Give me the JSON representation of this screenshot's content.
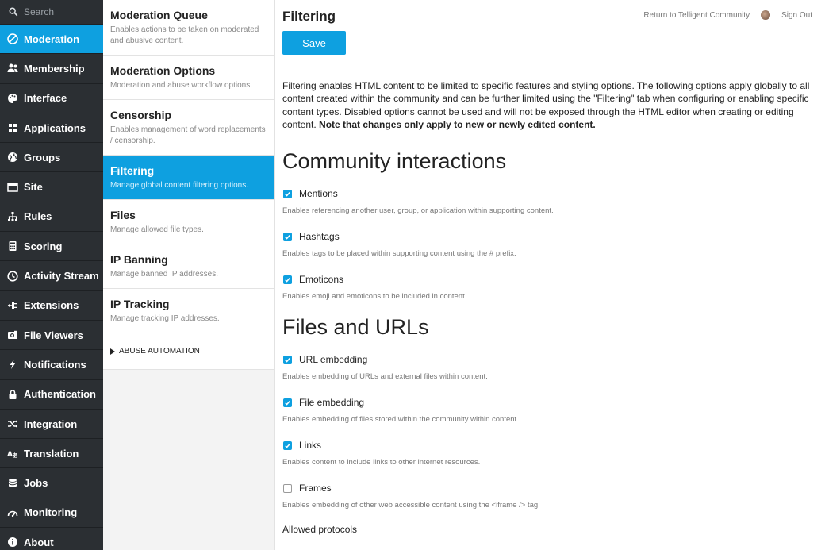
{
  "search": {
    "placeholder": "Search"
  },
  "nav": [
    {
      "label": "Moderation",
      "icon": "moderation-icon",
      "active": true
    },
    {
      "label": "Membership",
      "icon": "membership-icon"
    },
    {
      "label": "Interface",
      "icon": "palette-icon"
    },
    {
      "label": "Applications",
      "icon": "grid-icon"
    },
    {
      "label": "Groups",
      "icon": "globe-icon"
    },
    {
      "label": "Site",
      "icon": "window-icon"
    },
    {
      "label": "Rules",
      "icon": "hierarchy-icon"
    },
    {
      "label": "Scoring",
      "icon": "calculator-icon"
    },
    {
      "label": "Activity Stream",
      "icon": "clock-icon"
    },
    {
      "label": "Extensions",
      "icon": "plug-icon"
    },
    {
      "label": "File Viewers",
      "icon": "camera-icon"
    },
    {
      "label": "Notifications",
      "icon": "bolt-icon"
    },
    {
      "label": "Authentication",
      "icon": "lock-icon"
    },
    {
      "label": "Integration",
      "icon": "shuffle-icon"
    },
    {
      "label": "Translation",
      "icon": "translate-icon"
    },
    {
      "label": "Jobs",
      "icon": "database-icon"
    },
    {
      "label": "Monitoring",
      "icon": "gauge-icon"
    },
    {
      "label": "About",
      "icon": "info-icon"
    }
  ],
  "subnav": [
    {
      "title": "Moderation Queue",
      "desc": "Enables actions to be taken on moderated and abusive content."
    },
    {
      "title": "Moderation Options",
      "desc": "Moderation and abuse workflow options."
    },
    {
      "title": "Censorship",
      "desc": "Enables management of word replacements / censorship."
    },
    {
      "title": "Filtering",
      "desc": "Manage global content filtering options.",
      "active": true
    },
    {
      "title": "Files",
      "desc": "Manage allowed file types."
    },
    {
      "title": "IP Banning",
      "desc": "Manage banned IP addresses."
    },
    {
      "title": "IP Tracking",
      "desc": "Manage tracking IP addresses."
    }
  ],
  "abuse_automation": "ABUSE AUTOMATION",
  "header": {
    "title": "Filtering",
    "save_label": "Save",
    "return_link": "Return to Telligent Community",
    "signout_link": "Sign Out"
  },
  "intro": {
    "text": "Filtering enables HTML content to be limited to specific features and styling options. The following options apply globally to all content created within the community and can be further limited using the \"Filtering\" tab when configuring or enabling specific content types. Disabled options cannot be used and will not be exposed through the HTML editor when creating or editing content.",
    "note": "Note that changes only apply to new or newly edited content."
  },
  "sections": [
    {
      "heading": "Community interactions",
      "options": [
        {
          "label": "Mentions",
          "checked": true,
          "desc": "Enables referencing another user, group, or application within supporting content."
        },
        {
          "label": "Hashtags",
          "checked": true,
          "desc": "Enables tags to be placed within supporting content using the # prefix."
        },
        {
          "label": "Emoticons",
          "checked": true,
          "desc": "Enables emoji and emoticons to be included in content."
        }
      ]
    },
    {
      "heading": "Files and URLs",
      "options": [
        {
          "label": "URL embedding",
          "checked": true,
          "desc": "Enables embedding of URLs and external files within content."
        },
        {
          "label": "File embedding",
          "checked": true,
          "desc": "Enables embedding of files stored within the community within content."
        },
        {
          "label": "Links",
          "checked": true,
          "desc": "Enables content to include links to other internet resources."
        },
        {
          "label": "Frames",
          "checked": false,
          "desc": "Enables embedding of other web accessible content using the <iframe /> tag."
        }
      ]
    }
  ],
  "cutoff_label": "Allowed protocols"
}
